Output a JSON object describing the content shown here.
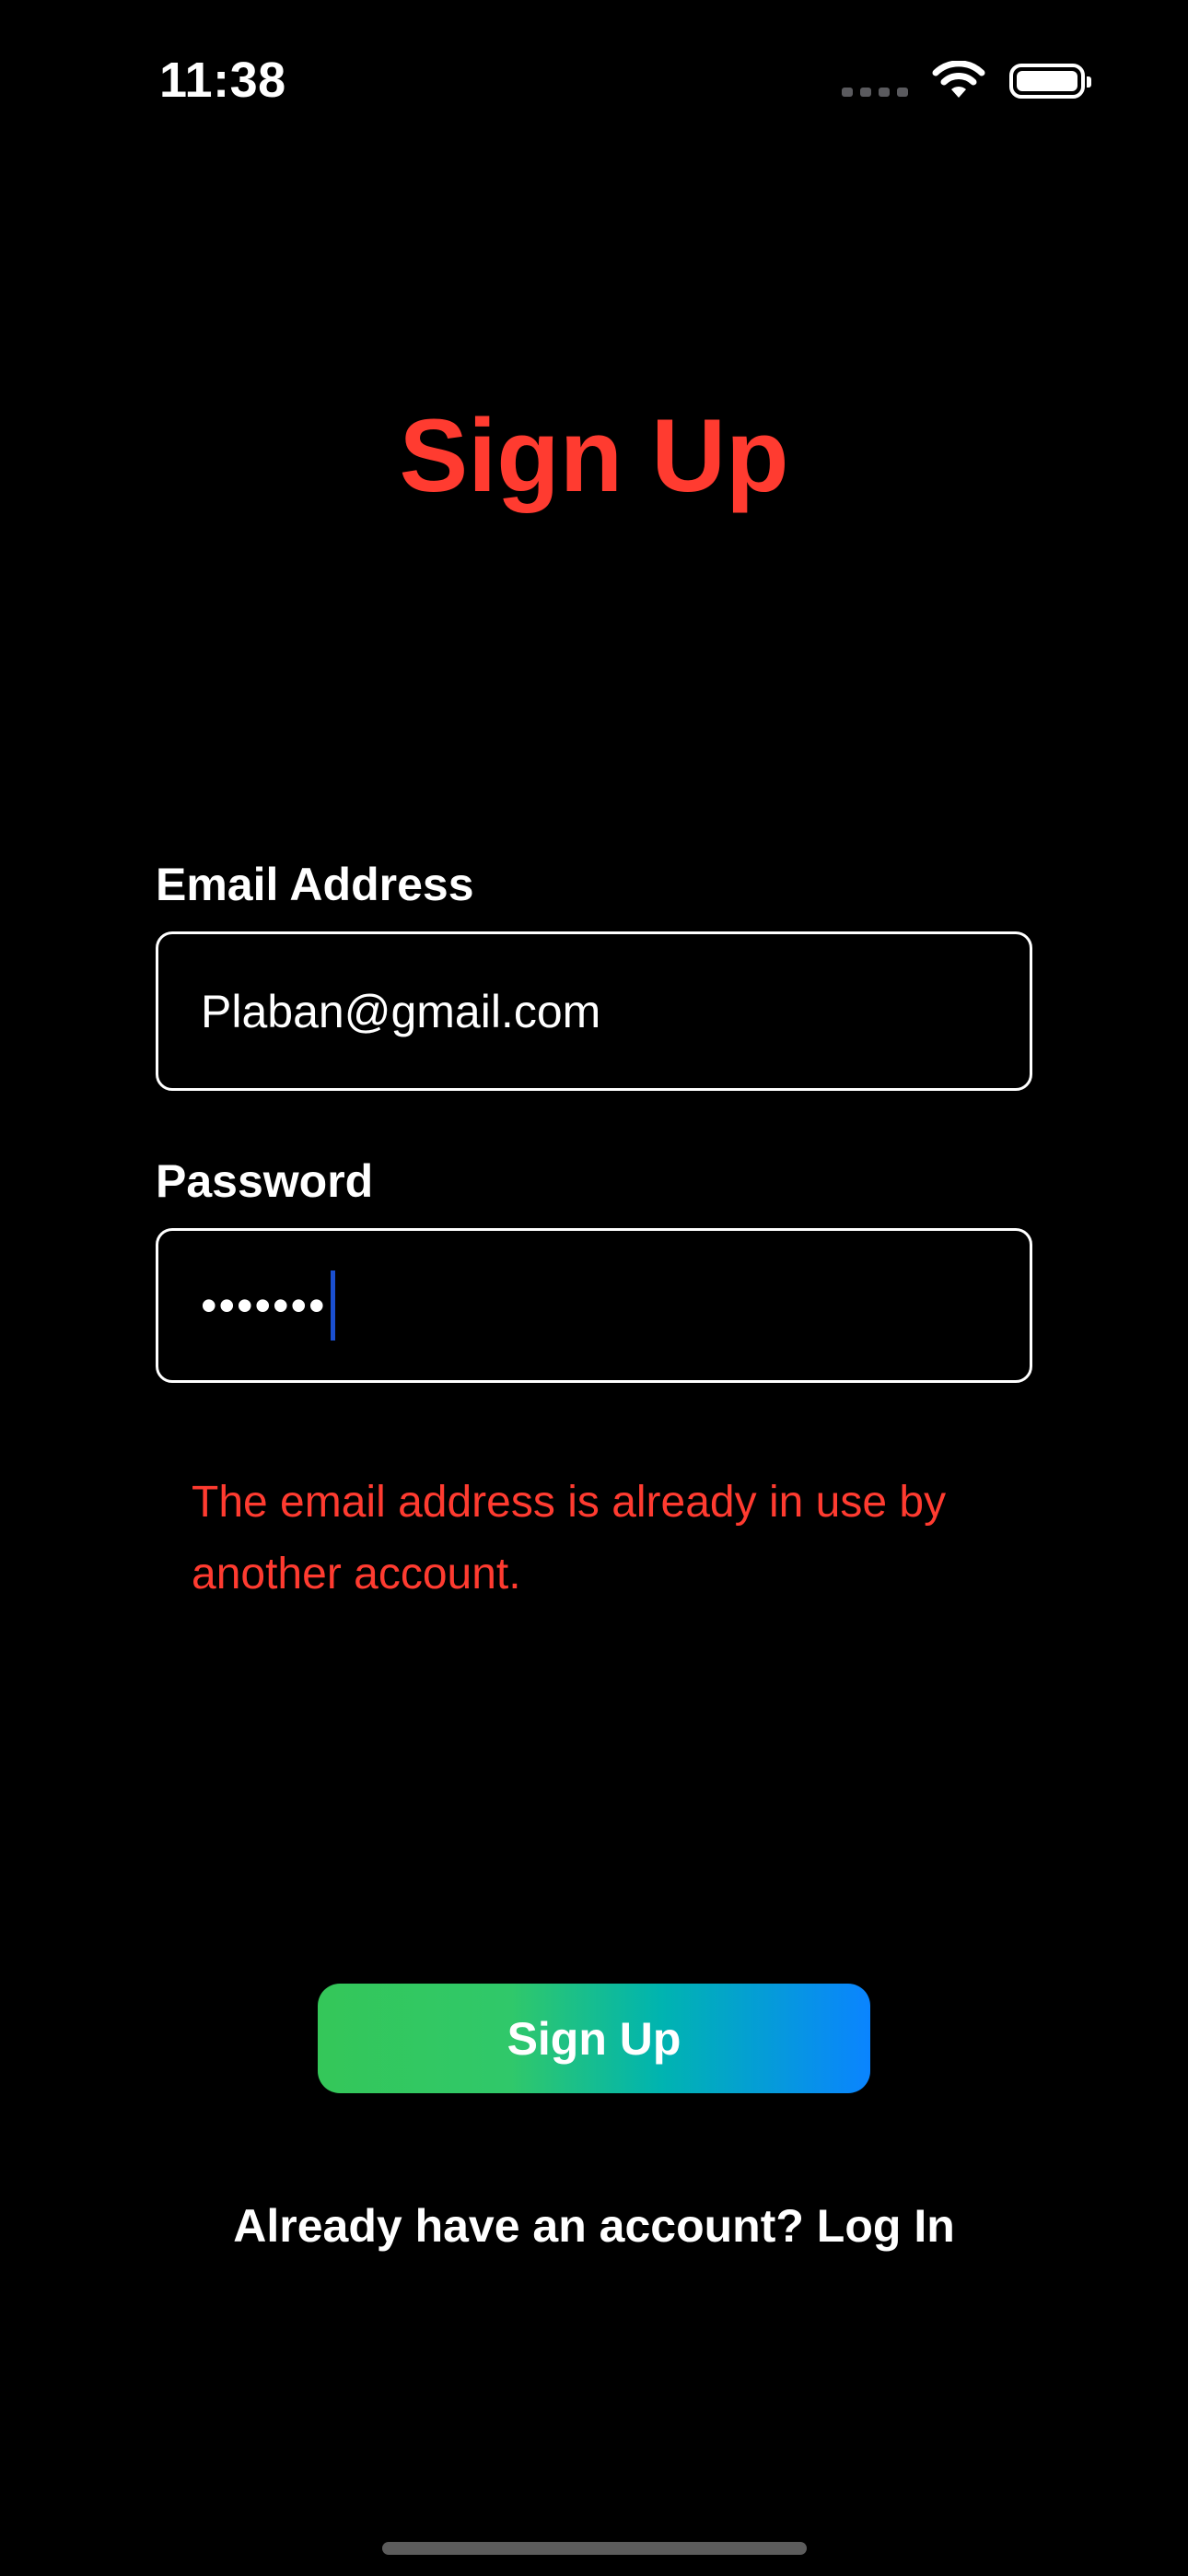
{
  "status_bar": {
    "time": "11:38",
    "icons": [
      "cellular-signal-icon",
      "wifi-icon",
      "battery-icon"
    ]
  },
  "title": "Sign Up",
  "form": {
    "email_label": "Email Address",
    "email_value": "Plaban@gmail.com",
    "password_label": "Password",
    "password_masked": "•••••••"
  },
  "error_message": "The email address is already in use by another account.",
  "signup_button_label": "Sign Up",
  "login_prompt": "Already have an account? Log In",
  "colors": {
    "title": "#FF3B30",
    "error": "#FF3B30",
    "button_gradient_start": "#34C759",
    "button_gradient_end": "#0A84FF",
    "background": "#000000"
  }
}
